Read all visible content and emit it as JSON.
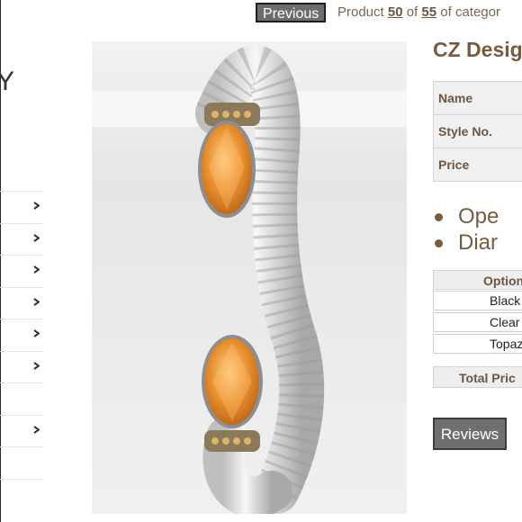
{
  "nav": {
    "previous_label": "Previous",
    "pager_prefix": "Product",
    "current": "50",
    "of_word": "of",
    "total": "55",
    "pager_suffix": "of categor"
  },
  "brand": {
    "partial_text": "Y"
  },
  "menu": {
    "items": [
      {
        "has_arrow": true
      },
      {
        "has_arrow": true
      },
      {
        "has_arrow": true
      },
      {
        "has_arrow": true
      },
      {
        "has_arrow": true
      },
      {
        "has_arrow": true
      },
      {
        "has_arrow": false
      },
      {
        "has_arrow": true
      },
      {
        "has_arrow": false
      },
      {
        "has_arrow": false
      }
    ],
    "arrow_icon": "chevron-right-icon"
  },
  "product": {
    "image_alt": "Twisted cable cuff bracelet with orange oval CZ stones",
    "title": "CZ Desig",
    "specs": [
      {
        "label": "Name"
      },
      {
        "label": "Style No."
      },
      {
        "label": "Price"
      }
    ],
    "features": [
      "Ope",
      "Diar"
    ],
    "options_header": "Option",
    "options": [
      "Black",
      "Clear",
      "Topaz"
    ],
    "total_label": "Total Pric",
    "reviews_label": "Reviews"
  },
  "colors": {
    "accent_brown": "#7a5a3c",
    "button_gray": "#6f6f6f",
    "stone_orange": "#e08a2a"
  }
}
